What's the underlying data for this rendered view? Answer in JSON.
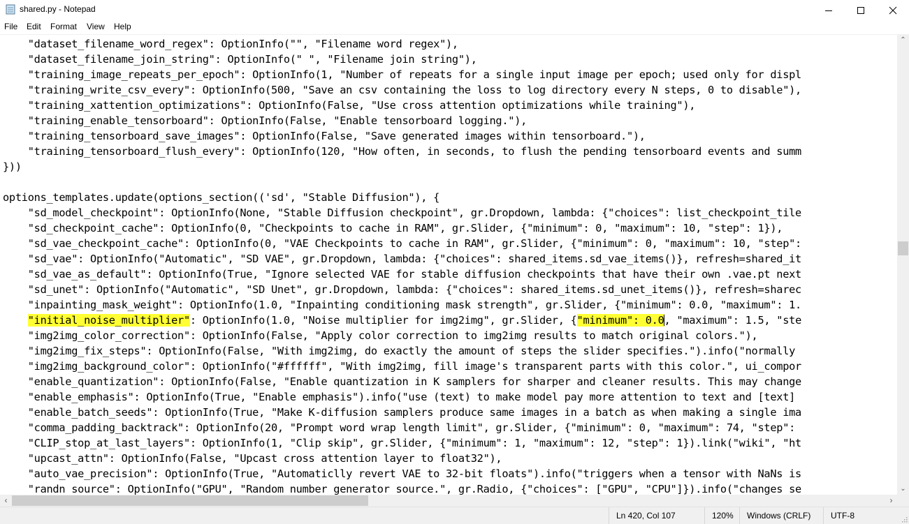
{
  "window": {
    "title": "shared.py - Notepad",
    "controls": {
      "minimize": "minimize-icon",
      "maximize": "maximize-icon",
      "close": "close-icon"
    }
  },
  "menu": [
    "File",
    "Edit",
    "Format",
    "View",
    "Help"
  ],
  "editor": {
    "lines": [
      {
        "pre": "    \"dataset_filename_word_regex\": OptionInfo(\"\", \"Filename word regex\"),"
      },
      {
        "pre": "    \"dataset_filename_join_string\": OptionInfo(\" \", \"Filename join string\"),"
      },
      {
        "pre": "    \"training_image_repeats_per_epoch\": OptionInfo(1, \"Number of repeats for a single input image per epoch; used only for displ"
      },
      {
        "pre": "    \"training_write_csv_every\": OptionInfo(500, \"Save an csv containing the loss to log directory every N steps, 0 to disable\"),"
      },
      {
        "pre": "    \"training_xattention_optimizations\": OptionInfo(False, \"Use cross attention optimizations while training\"),"
      },
      {
        "pre": "    \"training_enable_tensorboard\": OptionInfo(False, \"Enable tensorboard logging.\"),"
      },
      {
        "pre": "    \"training_tensorboard_save_images\": OptionInfo(False, \"Save generated images within tensorboard.\"),"
      },
      {
        "pre": "    \"training_tensorboard_flush_every\": OptionInfo(120, \"How often, in seconds, to flush the pending tensorboard events and summ"
      },
      {
        "pre": "}))"
      },
      {
        "pre": ""
      },
      {
        "pre": "options_templates.update(options_section(('sd', \"Stable Diffusion\"), {"
      },
      {
        "pre": "    \"sd_model_checkpoint\": OptionInfo(None, \"Stable Diffusion checkpoint\", gr.Dropdown, lambda: {\"choices\": list_checkpoint_tile"
      },
      {
        "pre": "    \"sd_checkpoint_cache\": OptionInfo(0, \"Checkpoints to cache in RAM\", gr.Slider, {\"minimum\": 0, \"maximum\": 10, \"step\": 1}),"
      },
      {
        "pre": "    \"sd_vae_checkpoint_cache\": OptionInfo(0, \"VAE Checkpoints to cache in RAM\", gr.Slider, {\"minimum\": 0, \"maximum\": 10, \"step\":"
      },
      {
        "pre": "    \"sd_vae\": OptionInfo(\"Automatic\", \"SD VAE\", gr.Dropdown, lambda: {\"choices\": shared_items.sd_vae_items()}, refresh=shared_it"
      },
      {
        "pre": "    \"sd_vae_as_default\": OptionInfo(True, \"Ignore selected VAE for stable diffusion checkpoints that have their own .vae.pt next"
      },
      {
        "pre": "    \"sd_unet\": OptionInfo(\"Automatic\", \"SD Unet\", gr.Dropdown, lambda: {\"choices\": shared_items.sd_unet_items()}, refresh=sharec"
      },
      {
        "pre": "    \"inpainting_mask_weight\": OptionInfo(1.0, \"Inpainting conditioning mask strength\", gr.Slider, {\"minimum\": 0.0, \"maximum\": 1."
      },
      {
        "pre": "    ",
        "hl1": "\"initial_noise_multiplier\"",
        "mid": ": OptionInfo(1.0, \"Noise multiplier for img2img\", gr.Slider, {",
        "hl2": "\"minimum\": 0.0",
        "post": ", \"maximum\": 1.5, \"ste"
      },
      {
        "pre": "    \"img2img_color_correction\": OptionInfo(False, \"Apply color correction to img2img results to match original colors.\"),"
      },
      {
        "pre": "    \"img2img_fix_steps\": OptionInfo(False, \"With img2img, do exactly the amount of steps the slider specifies.\").info(\"normally "
      },
      {
        "pre": "    \"img2img_background_color\": OptionInfo(\"#ffffff\", \"With img2img, fill image's transparent parts with this color.\", ui_compor"
      },
      {
        "pre": "    \"enable_quantization\": OptionInfo(False, \"Enable quantization in K samplers for sharper and cleaner results. This may change"
      },
      {
        "pre": "    \"enable_emphasis\": OptionInfo(True, \"Enable emphasis\").info(\"use (text) to make model pay more attention to text and [text]"
      },
      {
        "pre": "    \"enable_batch_seeds\": OptionInfo(True, \"Make K-diffusion samplers produce same images in a batch as when making a single ima"
      },
      {
        "pre": "    \"comma_padding_backtrack\": OptionInfo(20, \"Prompt word wrap length limit\", gr.Slider, {\"minimum\": 0, \"maximum\": 74, \"step\":"
      },
      {
        "pre": "    \"CLIP_stop_at_last_layers\": OptionInfo(1, \"Clip skip\", gr.Slider, {\"minimum\": 1, \"maximum\": 12, \"step\": 1}).link(\"wiki\", \"ht"
      },
      {
        "pre": "    \"upcast_attn\": OptionInfo(False, \"Upcast cross attention layer to float32\"),"
      },
      {
        "pre": "    \"auto_vae_precision\": OptionInfo(True, \"Automaticlly revert VAE to 32-bit floats\").info(\"triggers when a tensor with NaNs is"
      },
      {
        "pre": "    \"randn_source\": OptionInfo(\"GPU\", \"Random number generator source.\", gr.Radio, {\"choices\": [\"GPU\", \"CPU\"]}).info(\"changes se"
      }
    ],
    "highlight_color": "#ffff33"
  },
  "statusbar": {
    "position": "Ln 420, Col 107",
    "zoom": "120%",
    "line_ending": "Windows (CRLF)",
    "encoding": "UTF-8"
  },
  "scrollbars": {
    "vertical_position": 0.47,
    "horizontal_position": 0.0
  }
}
